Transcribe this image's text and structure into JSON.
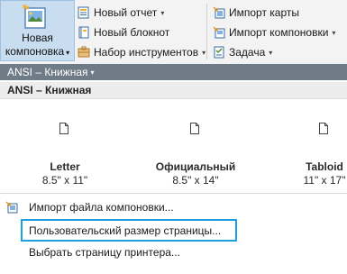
{
  "ribbon": {
    "new_layout": {
      "line1": "Новая",
      "line2": "компоновка"
    },
    "new_report": "Новый отчет",
    "new_notebook": "Новый блокнот",
    "toolsets": "Набор инструментов",
    "import_map": "Импорт карты",
    "import_layout": "Импорт компоновки",
    "tasks": "Задача"
  },
  "dropdown": {
    "selected": "ANSI – Книжная",
    "group_title": "ANSI – Книжная"
  },
  "pages": [
    {
      "name": "Letter",
      "size": "8.5\" x 11\""
    },
    {
      "name": "Официальный",
      "size": "8.5\" x 14\""
    },
    {
      "name": "Tabloid",
      "size": "11\" x 17\""
    }
  ],
  "menu": {
    "import_layout_file": "Импорт файла компоновки...",
    "custom_page_size": "Пользовательский размер страницы...",
    "choose_printer_page": "Выбрать страницу принтера..."
  },
  "colors": {
    "accent": "#1ba1e2",
    "header_bg": "#6f7b86",
    "selected_button_bg": "#c9ddf0"
  }
}
